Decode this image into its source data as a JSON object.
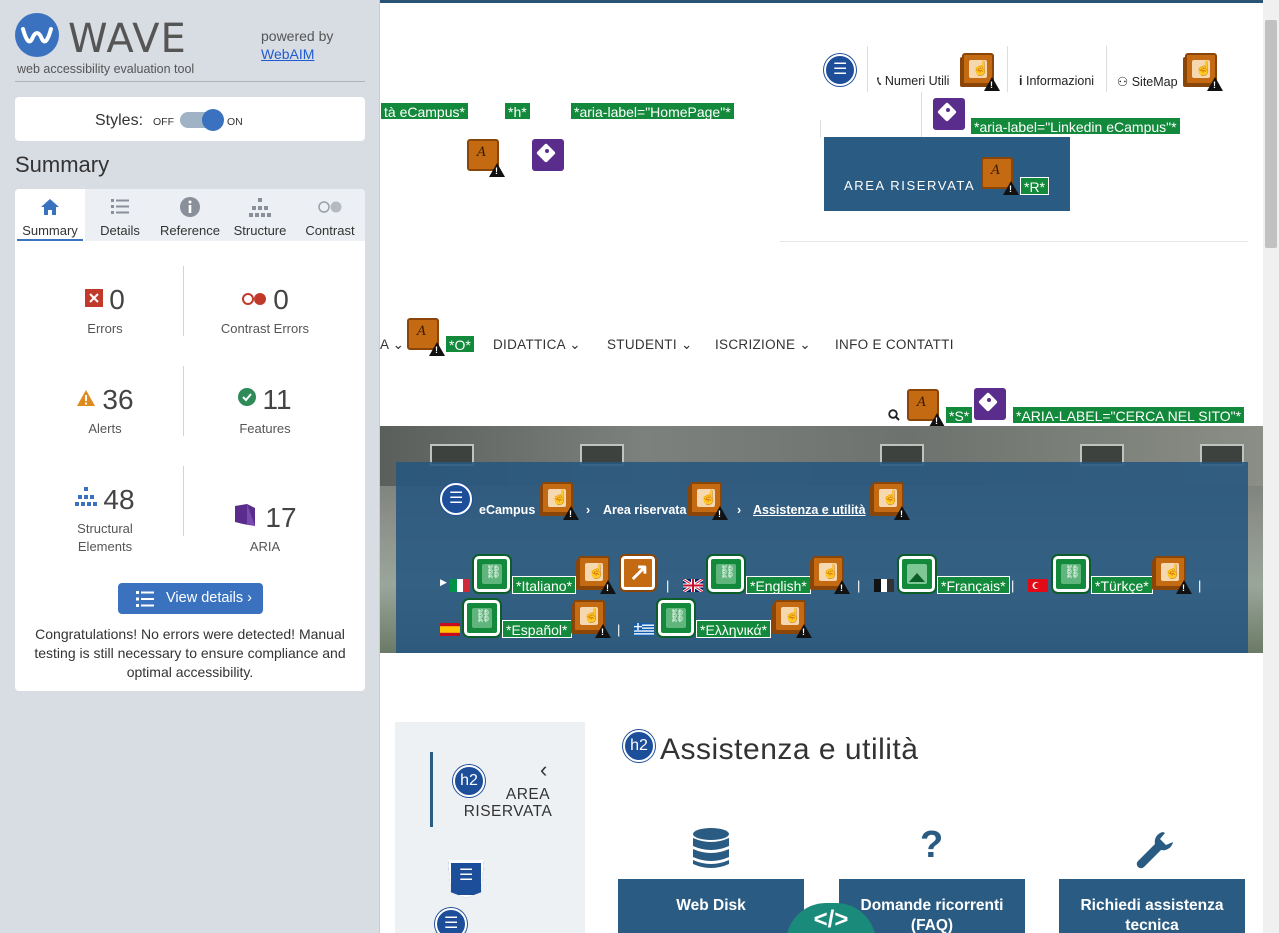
{
  "wave": {
    "title": "WAVE",
    "subtitle": "web accessibility evaluation tool",
    "powered_by": "powered by",
    "webaim": "WebAIM",
    "styles_label": "Styles:",
    "styles_off": "OFF",
    "styles_on": "ON",
    "summary_heading": "Summary",
    "tabs": [
      {
        "label": "Summary",
        "icon": "home-icon"
      },
      {
        "label": "Details",
        "icon": "list-icon"
      },
      {
        "label": "Reference",
        "icon": "info-icon"
      },
      {
        "label": "Structure",
        "icon": "hierarchy-icon"
      },
      {
        "label": "Contrast",
        "icon": "contrast-icon"
      }
    ],
    "stats": {
      "errors": {
        "value": "0",
        "label": "Errors"
      },
      "contrast_errors": {
        "value": "0",
        "label": "Contrast Errors"
      },
      "alerts": {
        "value": "36",
        "label": "Alerts"
      },
      "features": {
        "value": "11",
        "label": "Features"
      },
      "structural": {
        "value": "48",
        "label_1": "Structural",
        "label_2": "Elements"
      },
      "aria": {
        "value": "17",
        "label": "ARIA"
      }
    },
    "view_details": "View details ›",
    "congrats": "Congratulations! No errors were detected! Manual testing is still necessary to ensure compliance and optimal accessibility.",
    "colors": {
      "accent": "#3a72c0",
      "sidebar_bg": "#d8dce3",
      "error": "#c0392b",
      "alert": "#e08a1e",
      "feature": "#2e8b57",
      "aria": "#5a2d8c"
    }
  },
  "page": {
    "tags": {
      "ecampus_partial": "tà eCampus*",
      "h": "*h*",
      "homepage": "*aria-label=\"HomePage\"*",
      "linkedin": "*aria-label=\"Linkedin eCampus\"*",
      "r": "*R*",
      "o": "*O*",
      "s": "*S*",
      "cerca": "*ARIA-LABEL=\"CERCA NEL SITO\"*"
    },
    "toplinks": {
      "numeri": "Numeri Utili",
      "info": "Informazioni",
      "sitemap": "SiteMap"
    },
    "area_riservata_btn": "AREA RISERVATA",
    "nav": {
      "partial": "A",
      "didattica": "DIDATTICA",
      "studenti": "STUDENTI",
      "iscrizione": "ISCRIZIONE",
      "info": "INFO E CONTATTI",
      "chevron": "⌄"
    },
    "breadcrumb": {
      "home": "eCampus",
      "area": "Area riservata",
      "current": "Assistenza e utilità",
      "sep": "›"
    },
    "languages": {
      "it": "*Italiano*",
      "en": "*English*",
      "fr": "*Français*",
      "tr": "*Türkçe*",
      "es": "*Español*",
      "el": "*Ελληνικά*",
      "sep": "|"
    },
    "side": {
      "h2": "h2",
      "area_1": "AREA",
      "area_2": "RISERVATA",
      "chevron": "‹"
    },
    "main_heading": "Assistenza e utilità",
    "cards": {
      "webdisk": "Web Disk",
      "faq": "Domande ricorrenti (FAQ)",
      "assist": "Richiedi assistenza tecnica",
      "faq_icon": "?",
      "code": "</>"
    }
  }
}
